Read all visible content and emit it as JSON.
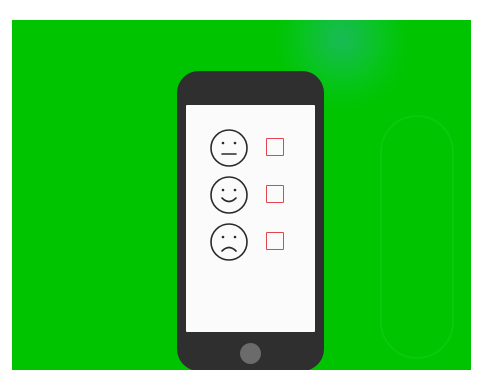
{
  "colors": {
    "background": "#00c400",
    "phone_body": "#2f2f2f",
    "screen": "#fbfbfb",
    "face_stroke": "#2a2a2a",
    "checkbox_border": "#e1464f",
    "home_button": "#6b6b6b"
  },
  "survey": {
    "options": [
      {
        "icon": "neutral-face-icon",
        "checked": false
      },
      {
        "icon": "smiling-face-icon",
        "checked": false
      },
      {
        "icon": "sad-face-icon",
        "checked": false
      }
    ]
  }
}
